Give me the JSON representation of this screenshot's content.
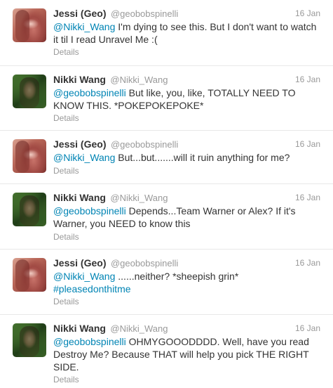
{
  "tweets": [
    {
      "name": "Jessi (Geo)",
      "handle": "@geobobspinelli",
      "time": "16 Jan",
      "avatar": "jessi-avatar",
      "mention": "@Nikki_Wang",
      "text_line1": " I'm dying to see this. But I don't want to watch",
      "text_line2": "it til I read Unravel Me :(",
      "details": "Details"
    },
    {
      "name": "Nikki Wang",
      "handle": "@Nikki_Wang",
      "time": "16 Jan",
      "avatar": "nikki-avatar",
      "mention": "@geobobspinelli",
      "text_line1": " But like, you, like, TOTALLY NEED TO",
      "text_line2": "KNOW THIS. *POKEPOKEPOKE*",
      "details": "Details"
    },
    {
      "name": "Jessi (Geo)",
      "handle": "@geobobspinelli",
      "time": "16 Jan",
      "avatar": "jessi-avatar",
      "mention": "@Nikki_Wang",
      "text_line1": " But...but.......will it ruin anything for me?",
      "details": "Details"
    },
    {
      "name": "Nikki Wang",
      "handle": "@Nikki_Wang",
      "time": "16 Jan",
      "avatar": "nikki-avatar",
      "mention": "@geobobspinelli",
      "text_line1": " Depends...Team Warner or Alex? If it's",
      "text_line2": "Warner, you NEED to know this",
      "details": "Details"
    },
    {
      "name": "Jessi (Geo)",
      "handle": "@geobobspinelli",
      "time": "16 Jan",
      "avatar": "jessi-avatar",
      "mention": "@Nikki_Wang",
      "text_line1": " ......neither? *sheepish grin*",
      "hashtag": "#pleasedonthitme",
      "details": "Details"
    },
    {
      "name": "Nikki Wang",
      "handle": "@Nikki_Wang",
      "time": "16 Jan",
      "avatar": "nikki-avatar",
      "mention": "@geobobspinelli",
      "text_line1": " OHMYGOOODDDD. Well, have you read",
      "text_line2": "Destroy Me? Because THAT will help you pick THE RIGHT",
      "text_line3": "SIDE.",
      "details": "Details"
    }
  ]
}
